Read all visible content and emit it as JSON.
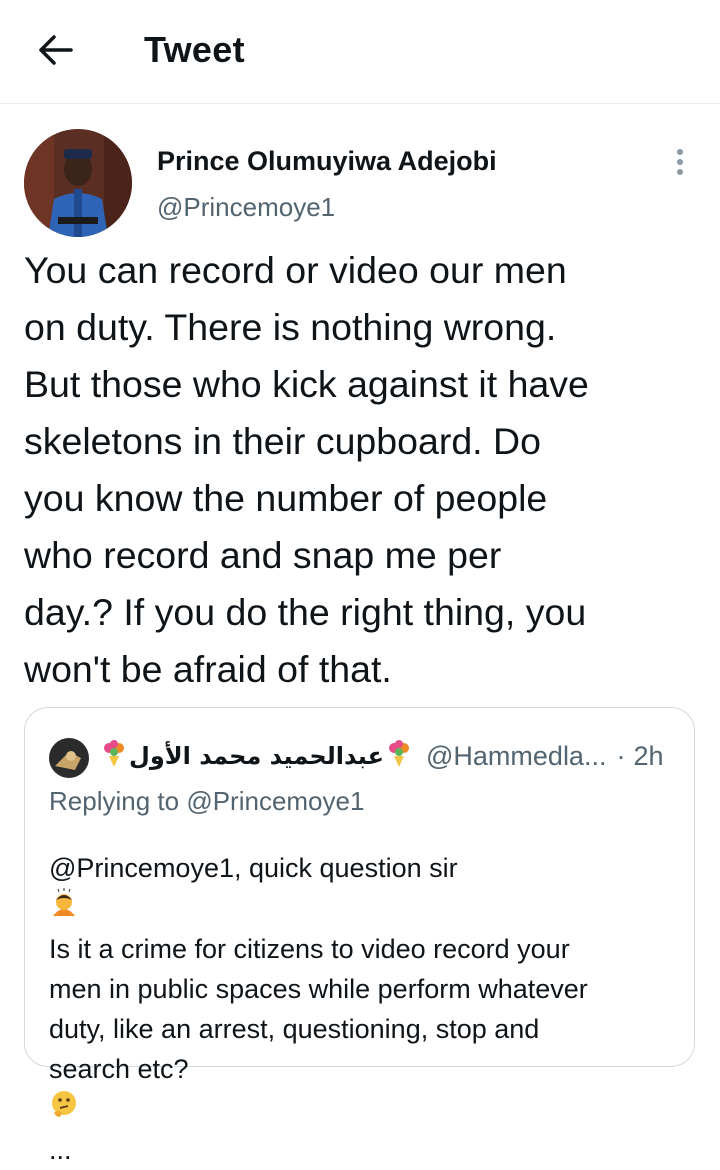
{
  "header": {
    "title": "Tweet",
    "back_icon": "arrow-left-icon"
  },
  "tweet": {
    "author_name": "Prince Olumuyiwa Adejobi",
    "author_handle": "@Princemoye1",
    "more_icon": "vertical-dots-icon",
    "text_lines": [
      "You can record or video our men",
      "on duty. There is nothing wrong.",
      "But those who kick against it have",
      "skeletons in their cupboard. Do",
      "you know the number of people",
      "who record and snap me per",
      "day.? If you do the right thing, you",
      "won't be afraid of that."
    ]
  },
  "quoted_tweet": {
    "name": "عبدالحميد محمد الأول",
    "handle": "@Hammedla...",
    "separator": "·",
    "time": "2h",
    "replying_label": "Replying to",
    "replying_to": "@Princemoye1",
    "body_lines": [
      "@Princemoye1, quick question sir",
      "Is it a crime for citizens to video record your",
      "men in public spaces while perform whatever",
      "duty, like an arrest, questioning, stop and",
      "search etc?"
    ],
    "truncation": "...",
    "emojis": [
      "bouquet",
      "person-bowing",
      "thinking-face"
    ]
  },
  "colors": {
    "text": "#0f1419",
    "secondary": "#536471",
    "border": "#cfd9de"
  }
}
